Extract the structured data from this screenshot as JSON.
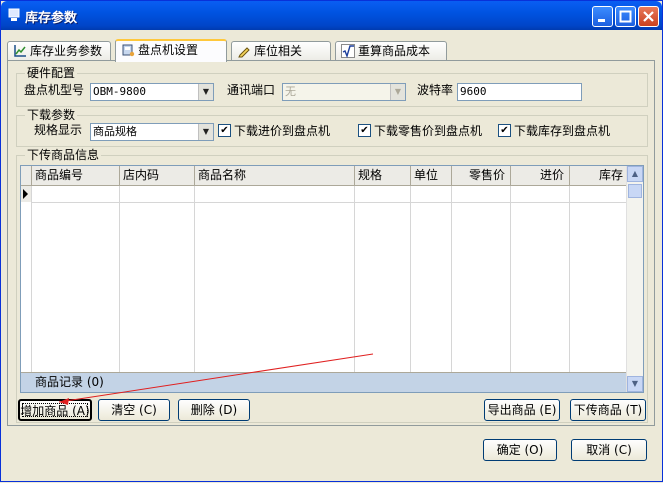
{
  "window": {
    "title": "库存参数"
  },
  "tabs": [
    {
      "label": "库存业务参数",
      "icon": "chart-icon"
    },
    {
      "label": "盘点机设置",
      "icon": "scanner-icon"
    },
    {
      "label": "库位相关",
      "icon": "pencil-icon"
    },
    {
      "label": "重算商品成本",
      "icon": "sqrt-icon"
    }
  ],
  "active_tab": "盘点机设置",
  "hardware": {
    "title": "硬件配置",
    "model_label": "盘点机型号",
    "model_value": "OBM-9800",
    "port_label": "通讯端口",
    "port_value": "无",
    "baud_label": "波特率",
    "baud_value": "9600"
  },
  "download": {
    "title": "下载参数",
    "spec_label": "规格显示",
    "spec_value": "商品规格",
    "options": [
      {
        "label": "下载进价到盘点机",
        "checked": true
      },
      {
        "label": "下载零售价到盘点机",
        "checked": true
      },
      {
        "label": "下载库存到盘点机",
        "checked": true
      }
    ]
  },
  "upload": {
    "title": "下传商品信息",
    "columns": [
      "商品编号",
      "店内码",
      "商品名称",
      "规格",
      "单位",
      "零售价",
      "进价",
      "库存"
    ],
    "footer": "商品记录 (0)",
    "buttons": {
      "add": "增加商品 (A)",
      "clear": "清空 (C)",
      "delete": "删除 (D)",
      "export": "导出商品 (E)",
      "download": "下传商品 (T)"
    }
  },
  "dialog_buttons": {
    "ok": "确定 (O)",
    "cancel": "取消 (C)"
  }
}
